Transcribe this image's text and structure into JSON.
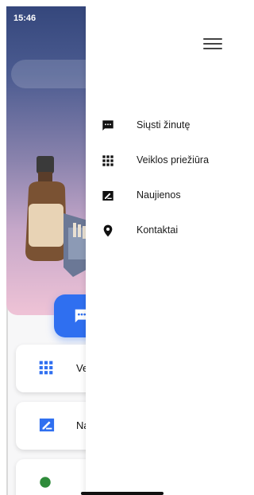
{
  "status_bar": {
    "time": "15:46"
  },
  "drawer": {
    "items": [
      {
        "label": "Siųsti žinutę",
        "icon": "message-icon"
      },
      {
        "label": "Veiklos priežiūra",
        "icon": "grid-icon"
      },
      {
        "label": "Naujienos",
        "icon": "news-icon"
      },
      {
        "label": "Kontaktai",
        "icon": "location-pin-icon"
      }
    ]
  },
  "background_cards": [
    {
      "label": "Ve",
      "icon": "grid-icon"
    },
    {
      "label": "Na",
      "icon": "news-icon"
    }
  ],
  "colors": {
    "accent": "#2f6ff0",
    "hero_top": "#35477c",
    "hero_bottom": "#efc3d6"
  }
}
